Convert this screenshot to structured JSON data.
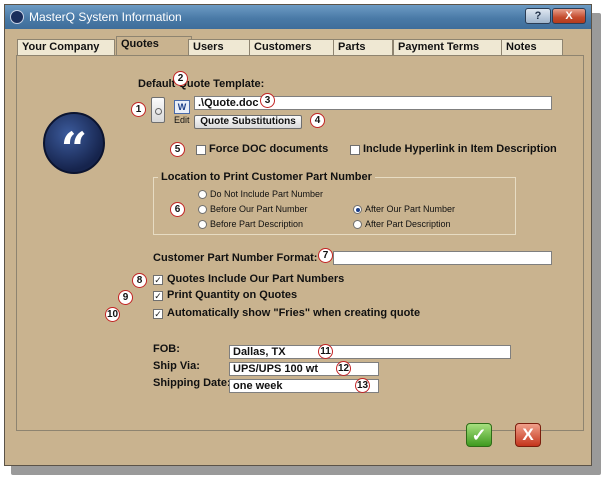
{
  "window": {
    "title": "MasterQ System Information",
    "help_label": "?",
    "close_label": "X"
  },
  "tabs": [
    {
      "label": "Your Company"
    },
    {
      "label": "Quotes"
    },
    {
      "label": "Users"
    },
    {
      "label": "Customers"
    },
    {
      "label": "Parts"
    },
    {
      "label": "Payment Terms"
    },
    {
      "label": "Notes"
    }
  ],
  "quotes": {
    "default_template_label": "Default Quote Template:",
    "template_path": ".\\Quote.doc",
    "edit_label": "Edit",
    "word_icon_label": "W",
    "quote_substitutions_label": "Quote Substitutions",
    "force_doc_label": "Force DOC documents",
    "force_doc_checked": false,
    "include_hyperlink_label": "Include Hyperlink in Item Description",
    "include_hyperlink_checked": false,
    "location_group_title": "Location to Print Customer Part Number",
    "location_options": [
      {
        "label": "Do Not Include Part Number",
        "selected": false
      },
      {
        "label": "Before Our Part Number",
        "selected": false
      },
      {
        "label": "Before Part Description",
        "selected": false
      },
      {
        "label": "After Our Part Number",
        "selected": true
      },
      {
        "label": "After Part Description",
        "selected": false
      }
    ],
    "customer_part_number_format_label": "Customer Part Number Format:",
    "customer_part_number_format_value": "",
    "include_our_part_numbers_label": "Quotes Include Our Part Numbers",
    "print_quantity_label": "Print Quantity on Quotes",
    "auto_show_fries_label": "Automatically show \"Fries\" when creating quote",
    "fob_label": "FOB:",
    "fob_value": "Dallas, TX",
    "ship_via_label": "Ship Via:",
    "ship_via_value": "UPS/UPS 100 wt",
    "shipping_date_label": "Shipping Date:",
    "shipping_date_value": "one week"
  },
  "markers": [
    "1",
    "2",
    "3",
    "4",
    "5",
    "6",
    "7",
    "8",
    "9",
    "10",
    "11",
    "12",
    "13"
  ],
  "buttons": {
    "ok_label": "✓",
    "cancel_label": "X"
  },
  "icons": {
    "app": "app-icon",
    "quote": "quote-logo",
    "word": "word-doc-icon"
  },
  "colors": {
    "panel_bg": "#c9b38f",
    "titlebar": "#4a7aa7",
    "marker_border": "#c22323"
  }
}
